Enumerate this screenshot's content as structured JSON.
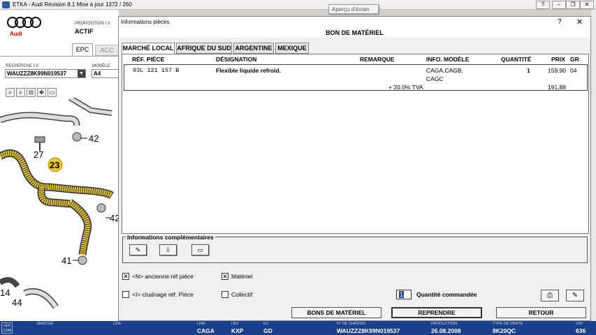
{
  "window": {
    "title": "ETKA - Audi Révision 8.1 Mise à jour 1372 / 260",
    "tooltip": "Aperçu d'écran"
  },
  "left": {
    "brand": "Audi",
    "proposition_label": "PROPOSITION I.V.",
    "proposition_value": "ACTIF",
    "tabs": [
      "EPC",
      "ACC"
    ],
    "recherche_label": "RECHERCHE I.V.",
    "recherche_value": "WAUZZZ8K99N019537",
    "modele_label": "MODÈLE",
    "modele_value": "A4",
    "callouts": [
      "42",
      "27",
      "23",
      "42",
      "41",
      "14",
      "44"
    ]
  },
  "dialog": {
    "title": "Informations pièces",
    "help": "?",
    "close": "✕",
    "heading": "BON DE MATÉRIEL",
    "tabs": [
      "MARCHÉ LOCAL",
      "AFRIQUE DU SUD",
      "ARGENTINE",
      "MEXIQUE"
    ],
    "columns": [
      "RÉF. PIÈCE",
      "DÉSIGNATION",
      "REMARQUE",
      "INFO. MODÈLE",
      "QUANTITÉ",
      "PRIX",
      "GR"
    ],
    "row": {
      "ref": "03L 121 157 B",
      "designation": "Flexible liquide refroid.",
      "info1": "CAGA,CAGB,",
      "info2": "CAGC",
      "quantite": "1",
      "prix": "159,90",
      "gr": "04",
      "tva_label": "+ 20.0% TVA",
      "tva_total": "191,88"
    },
    "info_comp_label": "Informations complémentaires",
    "checks": {
      "ancienne": "<N> ancienne réf pièce",
      "materiel": "Matériel",
      "chainage": "<I> chaînage réf. Pièce",
      "collectif": "Collectif"
    },
    "qty_value": "1",
    "qty_label": "Quantité commandée",
    "buttons": {
      "bons": "BONS DE MATÉRIEL",
      "reprendre": "REPRENDRE",
      "retour": "RETOUR"
    }
  },
  "status": {
    "logo": "LEX COM",
    "fields": [
      {
        "label": "MARCHÉ",
        "value": ""
      },
      {
        "label": "CDE",
        "value": ""
      },
      {
        "label": "LRM",
        "value": "CAGA"
      },
      {
        "label": "LBV",
        "value": "KXP"
      },
      {
        "label": "EC",
        "value": "GD"
      },
      {
        "label": "N° DE CHÂSSIS",
        "value": "WAUZZZ8K99N019537"
      },
      {
        "label": "PRODUCTION",
        "value": "26.08.2008"
      },
      {
        "label": "TYPE DE VENTE",
        "value": "8K20QC"
      },
      {
        "label": "CAT",
        "value": "636"
      }
    ]
  }
}
